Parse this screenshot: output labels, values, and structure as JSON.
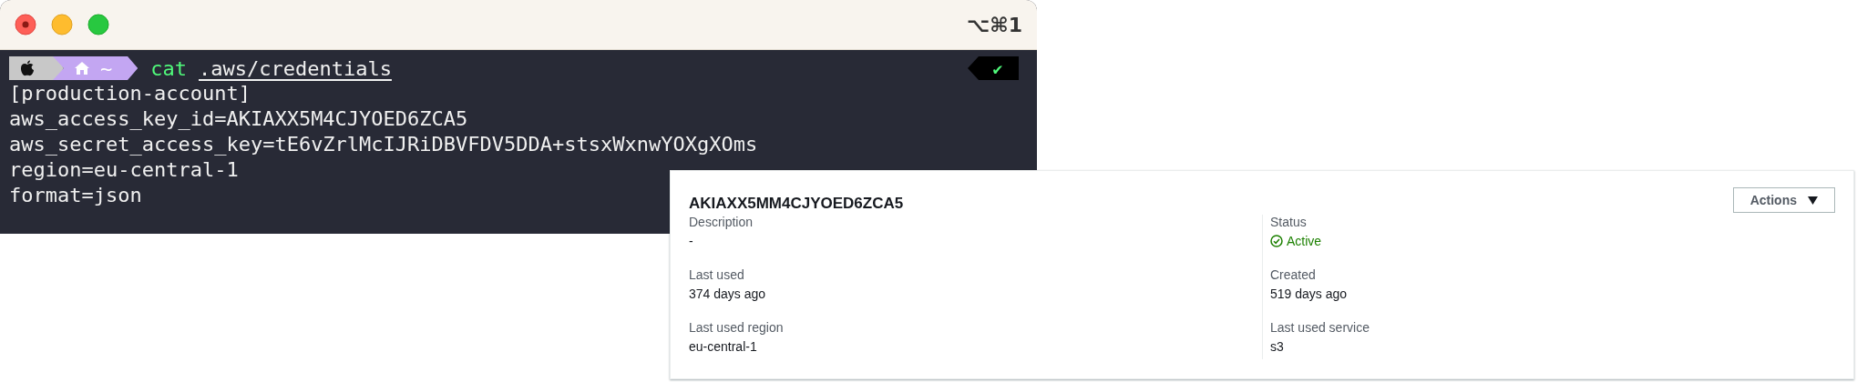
{
  "terminal": {
    "shortcut": "⌥⌘1",
    "prompt": {
      "path": "~",
      "command": "cat",
      "argument": ".aws/credentials",
      "status": "✔"
    },
    "output": [
      "[production-account]",
      "aws_access_key_id=AKIAXX5M4CJYOED6ZCA5",
      "aws_secret_access_key=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",
      "region=eu-central-1",
      "format=json"
    ]
  },
  "access_key_card": {
    "title": "AKIAXX5MM4CJYOED6ZCA5",
    "actions_button": "Actions",
    "columns": [
      [
        {
          "label": "Description",
          "value": "-",
          "kind": "text"
        },
        {
          "label": "Last used",
          "value": "374 days ago",
          "kind": "text"
        },
        {
          "label": "Last used region",
          "value": "eu-central-1",
          "kind": "text"
        }
      ],
      [
        {
          "label": "Status",
          "value": "Active",
          "kind": "status"
        },
        {
          "label": "Created",
          "value": "519 days ago",
          "kind": "text"
        },
        {
          "label": "Last used service",
          "value": "s3",
          "kind": "text"
        }
      ]
    ]
  }
}
